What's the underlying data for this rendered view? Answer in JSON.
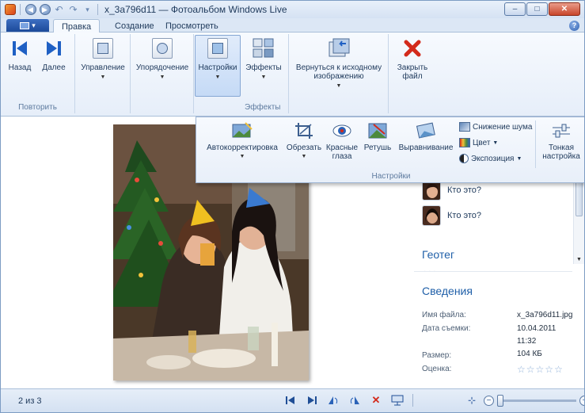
{
  "window": {
    "title": "x_3a796d11 — Фотоальбом Windows Live",
    "minimize": "–",
    "maximize": "□",
    "close": "✕"
  },
  "tabs": [
    {
      "label": "Правка",
      "active": true
    },
    {
      "label": "Создание",
      "active": false
    },
    {
      "label": "Просмотреть",
      "active": false
    }
  ],
  "help": "?",
  "ribbon": {
    "group_repeat": {
      "label": "Повторить",
      "back": "Назад",
      "next": "Далее"
    },
    "manage": "Управление",
    "arrange": "Упорядочение",
    "settings": "Настройки",
    "effects": "Эффекты",
    "group_effects_label": "Эффекты",
    "revert": "Вернуться к исходному изображению",
    "close_file": "Закрыть файл"
  },
  "settings_panel": {
    "autocorrect": "Автокорректировка",
    "crop": "Обрезать",
    "red_eye": "Красные глаза",
    "retouch": "Ретушь",
    "straighten": "Выравнивание",
    "noise": "Снижение шума",
    "color": "Цвет",
    "exposure": "Экспозиция",
    "fine_tune": "Тонкая настройка",
    "label": "Настройки"
  },
  "people": [
    {
      "label": "Кто это?"
    },
    {
      "label": "Кто это?"
    }
  ],
  "geotag": {
    "title": "Геотег"
  },
  "details": {
    "title": "Сведения",
    "filename_label": "Имя файла:",
    "filename": "x_3a796d11.jpg",
    "date_label": "Дата съемки:",
    "date": "10.04.2011",
    "time": "11:32",
    "size_label": "Размер:",
    "size": "104 КБ",
    "rating_label": "Оценка:",
    "rating": 0
  },
  "status": {
    "count": "2 из 3"
  },
  "colors": {
    "accent": "#1f5fa8",
    "ribbon": "#e6eef9",
    "delete": "#d32a1b"
  }
}
